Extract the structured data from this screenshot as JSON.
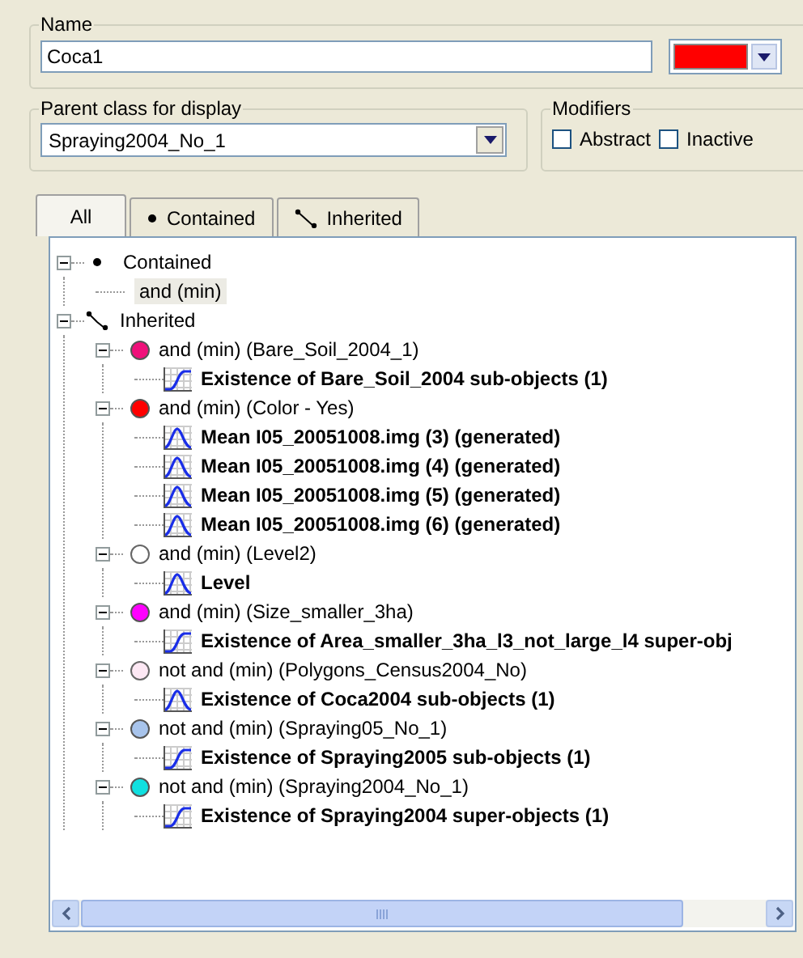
{
  "name": {
    "label": "Name",
    "value": "Coca1",
    "color": "#ff0000"
  },
  "parent_class": {
    "label": "Parent class for display",
    "value": "Spraying2004_No_1"
  },
  "modifiers": {
    "label": "Modifiers",
    "options": [
      {
        "label": "Abstract",
        "checked": false
      },
      {
        "label": "Inactive",
        "checked": false
      }
    ]
  },
  "tabs": [
    {
      "label": "All",
      "kind": "all",
      "selected": true
    },
    {
      "label": "Contained",
      "kind": "contained",
      "selected": false
    },
    {
      "label": "Inherited",
      "kind": "inherited",
      "selected": false
    }
  ],
  "tree": [
    {
      "kind": "contained",
      "label": "Contained",
      "selected": false,
      "expanded": true,
      "children": [
        {
          "kind": "operator",
          "label": "and (min)",
          "selected": true
        }
      ]
    },
    {
      "kind": "inherited",
      "label": "Inherited",
      "selected": false,
      "expanded": true,
      "children": [
        {
          "kind": "class",
          "label": "and (min) (Bare_Soil_2004_1)",
          "color": "#f0107a",
          "selected": false,
          "expanded": true,
          "children": [
            {
              "kind": "sigmoid",
              "label": "Existence of Bare_Soil_2004 sub-objects  (1)",
              "selected": false
            }
          ]
        },
        {
          "kind": "class",
          "label": "and (min) (Color - Yes)",
          "color": "#ff0000",
          "selected": false,
          "expanded": true,
          "children": [
            {
              "kind": "gaussian",
              "label": "Mean I05_20051008.img (3) (generated)",
              "selected": false
            },
            {
              "kind": "gaussian",
              "label": "Mean I05_20051008.img (4) (generated)",
              "selected": false
            },
            {
              "kind": "gaussian",
              "label": "Mean I05_20051008.img (5) (generated)",
              "selected": false
            },
            {
              "kind": "gaussian",
              "label": "Mean I05_20051008.img (6) (generated)",
              "selected": false
            }
          ]
        },
        {
          "kind": "class",
          "label": "and (min) (Level2)",
          "color": "#ffffff",
          "selected": false,
          "expanded": true,
          "children": [
            {
              "kind": "gaussian",
              "label": "Level",
              "selected": false
            }
          ]
        },
        {
          "kind": "class",
          "label": "and (min) (Size_smaller_3ha)",
          "color": "#ff00ff",
          "selected": false,
          "expanded": true,
          "children": [
            {
              "kind": "sigmoid",
              "label": "Existence of Area_smaller_3ha_l3_not_large_l4 super-obj",
              "selected": false
            }
          ]
        },
        {
          "kind": "class",
          "label": "not and (min) (Polygons_Census2004_No)",
          "color": "#fde8f4",
          "selected": false,
          "expanded": true,
          "children": [
            {
              "kind": "gaussian",
              "label": "Existence of Coca2004 sub-objects  (1)",
              "selected": false
            }
          ]
        },
        {
          "kind": "class",
          "label": "not and (min) (Spraying05_No_1)",
          "color": "#a8c4ec",
          "selected": false,
          "expanded": true,
          "children": [
            {
              "kind": "sigmoid",
              "label": "Existence of Spraying2005 sub-objects  (1)",
              "selected": false
            }
          ]
        },
        {
          "kind": "class",
          "label": "not and (min) (Spraying2004_No_1)",
          "color": "#10e0e0",
          "selected": false,
          "expanded": true,
          "children": [
            {
              "kind": "sigmoid",
              "label": "Existence of Spraying2004 super-objects  (1)",
              "selected": false
            }
          ]
        }
      ]
    }
  ]
}
